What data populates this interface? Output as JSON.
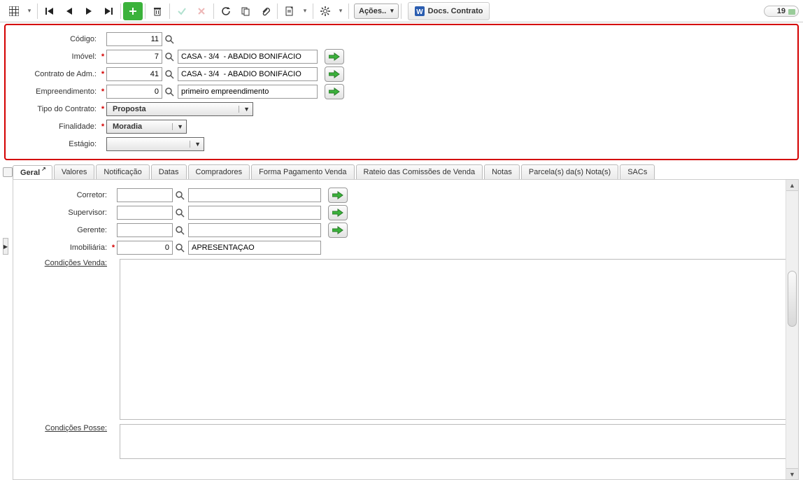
{
  "toolbar": {
    "actions_label": "Ações..",
    "docs_label": "Docs. Contrato",
    "counter": "19"
  },
  "header": {
    "codigo_label": "Código:",
    "codigo_value": "11",
    "imovel_label": "Imóvel:",
    "imovel_value": "7",
    "imovel_desc": "CASA - 3/4  - ABADIO BONIFÁCIO",
    "contrato_label": "Contrato de Adm.:",
    "contrato_value": "41",
    "contrato_desc": "CASA - 3/4  - ABADIO BONIFÁCIO",
    "empreend_label": "Empreendimento:",
    "empreend_value": "0",
    "empreend_desc": "primeiro empreendimento",
    "tipo_label": "Tipo do Contrato:",
    "tipo_value": "Proposta",
    "finalidade_label": "Finalidade:",
    "finalidade_value": "Moradia",
    "estagio_label": "Estágio:",
    "estagio_value": ""
  },
  "tabs": {
    "geral": "Geral",
    "valores": "Valores",
    "notificacao": "Notificação",
    "datas": "Datas",
    "compradores": "Compradores",
    "forma_pag": "Forma Pagamento Venda",
    "rateio": "Rateio das Comissões de Venda",
    "notas": "Notas",
    "parcelas": "Parcela(s) da(s) Nota(s)",
    "sacs": "SACs"
  },
  "geral": {
    "corretor_label": "Corretor:",
    "corretor_value": "",
    "corretor_desc": "",
    "supervisor_label": "Supervisor:",
    "supervisor_value": "",
    "supervisor_desc": "",
    "gerente_label": "Gerente:",
    "gerente_value": "",
    "gerente_desc": "",
    "imobiliaria_label": "Imobiliária:",
    "imobiliaria_value": "0",
    "imobiliaria_desc": "APRESENTAÇAO",
    "cond_venda_label": "Condições Venda:",
    "cond_venda_value": "",
    "cond_posse_label": "Condições Posse:",
    "cond_posse_value": ""
  }
}
